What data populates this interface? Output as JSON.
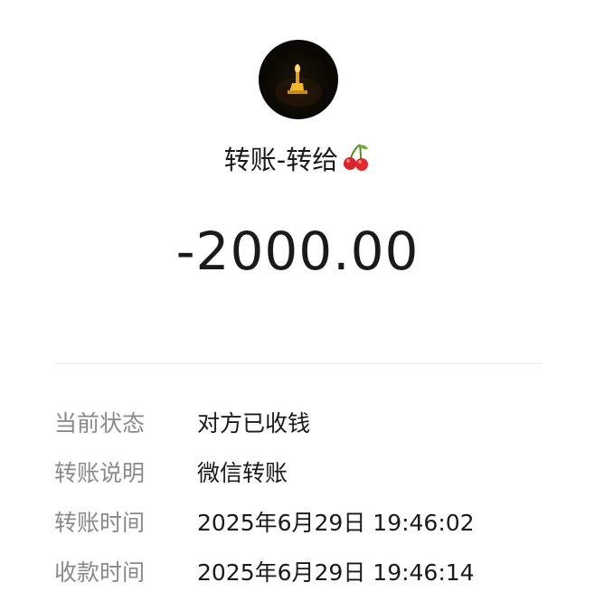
{
  "payee": {
    "avatar_icon": "candle-avatar",
    "title_text": "转账-转给",
    "title_emoji_icon": "cherry-emoji"
  },
  "transfer": {
    "amount": "-2000.00"
  },
  "details": [
    {
      "label": "当前状态",
      "value": "对方已收钱"
    },
    {
      "label": "转账说明",
      "value": "微信转账"
    },
    {
      "label": "转账时间",
      "value": "2025年6月29日 19:46:02"
    },
    {
      "label": "收款时间",
      "value": "2025年6月29日 19:46:14"
    }
  ],
  "colors": {
    "text_primary": "#1a1a1a",
    "text_secondary": "#8a8a8a",
    "divider": "#ececec",
    "background": "#ffffff"
  }
}
